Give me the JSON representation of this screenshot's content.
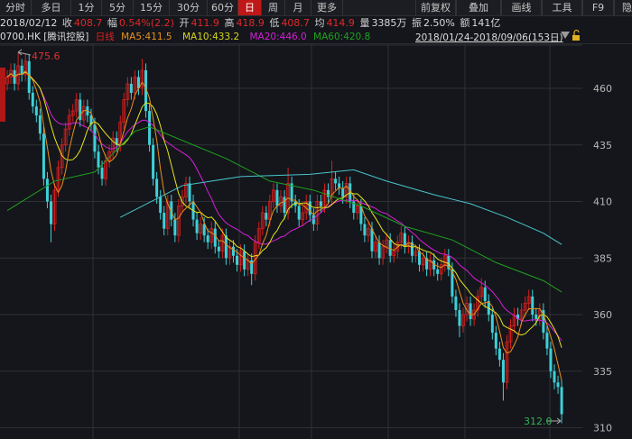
{
  "toolbar": {
    "left_tabs": [
      "分时",
      "多日",
      "1分",
      "5分",
      "15分",
      "30分",
      "60分",
      "日",
      "周",
      "月",
      "更多"
    ],
    "active_tab": "日",
    "right_tabs": [
      "前复权",
      "叠加",
      "画线",
      "工具",
      "F9",
      "隐藏"
    ]
  },
  "info": {
    "date": "2018/02/12",
    "close_label": "收",
    "close": "408.7",
    "change_label": "幅",
    "change": "0.54%(2.2)",
    "open_label": "开",
    "open": "411.9",
    "high_label": "高",
    "high": "418.9",
    "low_label": "低",
    "low": "408.7",
    "avg_label": "均",
    "avg": "414.9",
    "volume_label": "量",
    "volume": "3385万",
    "amplitude_label": "振",
    "amplitude": "2.50%",
    "turnover_label": "额",
    "turnover": "141亿"
  },
  "legend": {
    "symbol": "0700.HK",
    "name": "[腾讯控股]",
    "period": "日线",
    "ma5": "MA5:411.5",
    "ma10": "MA10:433.2",
    "ma20": "MA20:446.0",
    "ma60": "MA60:420.8",
    "range": "2018/01/24-2018/09/06(153日)"
  },
  "colors": {
    "up": "#d42020",
    "down": "#3ed0d8",
    "ma5": "#e8901c",
    "ma10": "#e6e61a",
    "ma20": "#d81ed8",
    "ma60": "#1fa01f",
    "long_ma": "#49c4cc",
    "background": "#14161b",
    "grid": "#2e3035"
  },
  "chart_data": {
    "type": "candlestick",
    "yticks": [
      460,
      435,
      410,
      385,
      360,
      335,
      310
    ],
    "ylim": [
      305,
      478
    ],
    "annotations": {
      "max": "475.6",
      "min": "312.0"
    },
    "open": [
      462,
      465,
      468,
      462,
      470,
      466,
      472,
      458,
      452,
      448,
      440,
      420,
      410,
      400,
      415,
      425,
      435,
      442,
      448,
      450,
      455,
      446,
      452,
      448,
      444,
      432,
      425,
      420,
      428,
      432,
      438,
      435,
      445,
      455,
      462,
      458,
      465,
      460,
      468,
      450,
      435,
      420,
      412,
      405,
      398,
      410,
      402,
      395,
      408,
      412,
      418,
      410,
      402,
      396,
      400,
      395,
      392,
      398,
      390,
      388,
      395,
      385,
      390,
      386,
      382,
      388,
      380,
      384,
      378,
      392,
      398,
      405,
      402,
      410,
      415,
      408,
      412,
      405,
      418,
      410,
      408,
      402,
      405,
      410,
      404,
      400,
      410,
      408,
      415,
      412,
      420,
      418,
      416,
      412,
      418,
      410,
      405,
      408,
      400,
      395,
      398,
      388,
      392,
      385,
      390,
      393,
      386,
      388,
      392,
      396,
      390,
      392,
      386,
      388,
      382,
      385,
      380,
      384,
      380,
      378,
      382,
      386,
      380,
      368,
      362,
      355,
      360,
      365,
      358,
      362,
      368,
      372,
      366,
      360,
      352,
      345,
      340,
      330,
      348,
      355,
      360,
      358,
      362,
      365,
      368,
      360,
      358,
      362,
      352,
      345,
      335,
      330,
      328
    ],
    "high": [
      468,
      471,
      471,
      475.6,
      473,
      475,
      475,
      461,
      455,
      451,
      443,
      423,
      413,
      418,
      428,
      438,
      445,
      451,
      453,
      458,
      458,
      455,
      455,
      451,
      447,
      435,
      428,
      431,
      435,
      441,
      441,
      448,
      458,
      465,
      465,
      468,
      468,
      473,
      471,
      453,
      438,
      423,
      415,
      408,
      413,
      413,
      405,
      411,
      415,
      421,
      421,
      413,
      405,
      403,
      403,
      398,
      401,
      401,
      393,
      398,
      398,
      393,
      393,
      389,
      391,
      391,
      387,
      387,
      395,
      401,
      408,
      408,
      413,
      418,
      418,
      415,
      415,
      425,
      421,
      413,
      411,
      408,
      413,
      413,
      407,
      413,
      413,
      418,
      418,
      428,
      423,
      421,
      419,
      421,
      421,
      413,
      411,
      411,
      403,
      401,
      401,
      395,
      395,
      393,
      396,
      396,
      391,
      395,
      399,
      399,
      395,
      395,
      391,
      391,
      388,
      388,
      387,
      387,
      383,
      385,
      389,
      389,
      383,
      371,
      365,
      363,
      368,
      368,
      365,
      371,
      376,
      375,
      369,
      363,
      355,
      348,
      343,
      351,
      358,
      363,
      363,
      365,
      368,
      371,
      371,
      363,
      365,
      365,
      355,
      348,
      338,
      333,
      331
    ],
    "low": [
      459,
      462,
      459,
      459,
      463,
      463,
      455,
      449,
      445,
      437,
      417,
      407,
      392,
      397,
      412,
      422,
      432,
      439,
      445,
      447,
      443,
      443,
      445,
      441,
      429,
      422,
      417,
      417,
      425,
      429,
      432,
      432,
      442,
      452,
      455,
      455,
      457,
      457,
      447,
      432,
      417,
      409,
      402,
      395,
      395,
      399,
      392,
      392,
      405,
      409,
      407,
      399,
      393,
      393,
      392,
      389,
      389,
      387,
      385,
      385,
      382,
      382,
      383,
      379,
      379,
      377,
      377,
      373,
      375,
      389,
      395,
      399,
      399,
      407,
      405,
      405,
      402,
      402,
      407,
      405,
      399,
      399,
      402,
      401,
      397,
      397,
      405,
      405,
      409,
      409,
      415,
      413,
      409,
      409,
      407,
      402,
      402,
      397,
      392,
      392,
      385,
      385,
      382,
      382,
      387,
      383,
      383,
      385,
      389,
      387,
      387,
      383,
      383,
      379,
      379,
      377,
      377,
      377,
      375,
      375,
      379,
      377,
      365,
      359,
      350,
      352,
      357,
      355,
      355,
      359,
      365,
      363,
      357,
      349,
      342,
      337,
      322,
      327,
      345,
      352,
      355,
      355,
      359,
      362,
      357,
      355,
      355,
      349,
      342,
      332,
      327,
      325,
      312
    ],
    "close": [
      465,
      468,
      462,
      470,
      466,
      472,
      458,
      452,
      448,
      440,
      420,
      410,
      400,
      415,
      425,
      435,
      442,
      448,
      450,
      455,
      446,
      452,
      448,
      444,
      432,
      425,
      420,
      428,
      432,
      438,
      435,
      445,
      455,
      462,
      458,
      465,
      460,
      468,
      450,
      435,
      420,
      412,
      405,
      398,
      410,
      402,
      395,
      408,
      412,
      418,
      410,
      402,
      396,
      400,
      395,
      392,
      398,
      390,
      388,
      395,
      385,
      390,
      386,
      382,
      388,
      380,
      384,
      378,
      392,
      398,
      405,
      402,
      410,
      415,
      408,
      412,
      405,
      418,
      410,
      408,
      402,
      405,
      410,
      404,
      400,
      410,
      408,
      415,
      412,
      420,
      418,
      416,
      412,
      418,
      410,
      405,
      408,
      400,
      395,
      398,
      388,
      392,
      385,
      390,
      393,
      386,
      388,
      392,
      396,
      390,
      392,
      386,
      388,
      382,
      385,
      380,
      384,
      380,
      378,
      382,
      386,
      380,
      368,
      362,
      355,
      360,
      365,
      358,
      362,
      368,
      372,
      366,
      360,
      352,
      345,
      340,
      330,
      348,
      355,
      360,
      358,
      362,
      365,
      368,
      360,
      358,
      362,
      352,
      345,
      335,
      330,
      328,
      316
    ],
    "ma60_points": [
      [
        0,
        406
      ],
      [
        13,
        419
      ],
      [
        24,
        423
      ],
      [
        35,
        441
      ],
      [
        39,
        443
      ],
      [
        48,
        437
      ],
      [
        60,
        429
      ],
      [
        72,
        419
      ],
      [
        84,
        415
      ],
      [
        97,
        408
      ],
      [
        109,
        399
      ],
      [
        122,
        393
      ],
      [
        134,
        383
      ],
      [
        147,
        375
      ],
      [
        152,
        370
      ]
    ],
    "long_ma_points": [
      [
        31,
        403
      ],
      [
        48,
        417
      ],
      [
        64,
        421
      ],
      [
        83,
        422
      ],
      [
        95,
        424
      ],
      [
        104,
        419
      ],
      [
        117,
        413
      ],
      [
        127,
        409
      ],
      [
        137,
        403
      ],
      [
        147,
        396
      ],
      [
        152,
        391
      ]
    ]
  }
}
